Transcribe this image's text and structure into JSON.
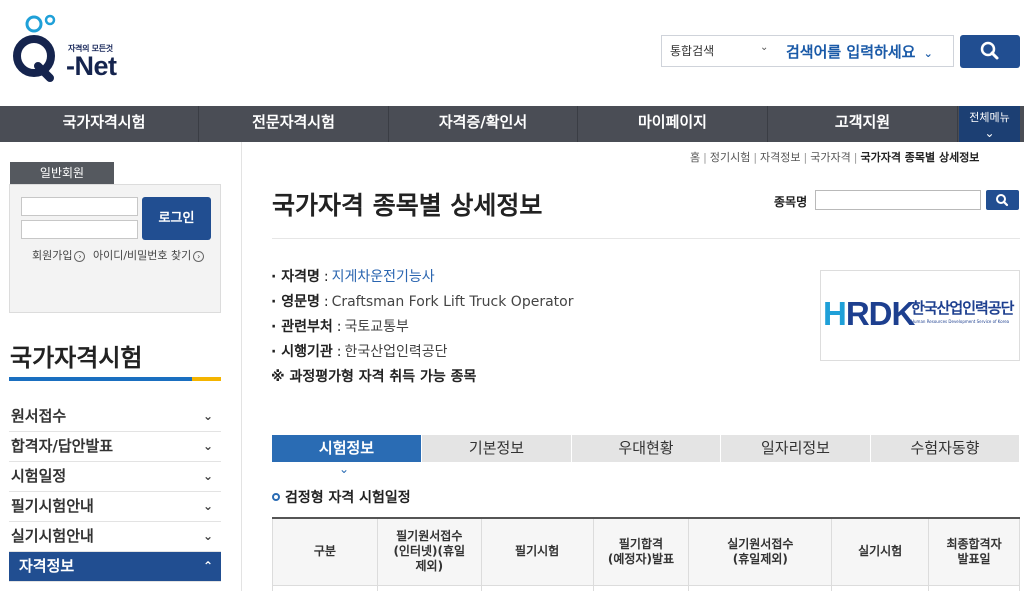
{
  "header": {
    "logo_tagline": "자격의 모든것",
    "logo_text": "-Net",
    "search": {
      "category": "통합검색",
      "placeholder": "검색어를 입력하세요"
    }
  },
  "gnb": {
    "items": [
      "국가자격시험",
      "전문자격시험",
      "자격증/확인서",
      "마이페이지",
      "고객지원"
    ],
    "all_menu": "전체메뉴"
  },
  "sidebar": {
    "login_tab": "일반회원",
    "login_button": "로그인",
    "join_link": "회원가입",
    "find_link": "아이디/비밀번호 찾기",
    "section_title": "국가자격시험",
    "menu": [
      {
        "label": "원서접수",
        "arrow": "⌄"
      },
      {
        "label": "합격자/답안발표",
        "arrow": "⌄"
      },
      {
        "label": "시험일정",
        "arrow": "⌄"
      },
      {
        "label": "필기시험안내",
        "arrow": "⌄"
      },
      {
        "label": "실기시험안내",
        "arrow": "⌄"
      },
      {
        "label": "자격정보",
        "arrow": "⌃"
      }
    ]
  },
  "breadcrumb": [
    "홈",
    "정기시험",
    "자격정보",
    "국가자격",
    "국가자격 종목별 상세정보"
  ],
  "main": {
    "title": "국가자격 종목별 상세정보",
    "search_label": "종목명",
    "info": {
      "name_key": "자격명",
      "name_val": "지게차운전기능사",
      "eng_key": "영문명",
      "eng_val": "Craftsman Fork Lift Truck Operator",
      "dept_key": "관련부처",
      "dept_val": "국토교통부",
      "org_key": "시행기관",
      "org_val": "한국산업인력공단",
      "note": "※ 과정평가형 자격 취득 가능 종목"
    },
    "org_logo": {
      "mark": "HRDK",
      "name": "한국산업인력공단",
      "en": "Human Resources Development Service of Korea"
    },
    "tabs": [
      "시험정보",
      "기본정보",
      "우대현황",
      "일자리정보",
      "수험자동향"
    ],
    "sub_title": "검정형 자격 시험일정",
    "table_headers": [
      "구분",
      "필기원서접수\n(인터넷)(휴일\n제외)",
      "필기시험",
      "필기합격\n(예정자)발표",
      "실기원서접수\n(휴일제외)",
      "실기시험",
      "최종합격자\n발표일"
    ]
  },
  "colors": {
    "brand_blue": "#214e91",
    "tab_active": "#2a6cb4",
    "gnb_bg": "#4a4d55",
    "accent_yellow": "#f4b400"
  }
}
